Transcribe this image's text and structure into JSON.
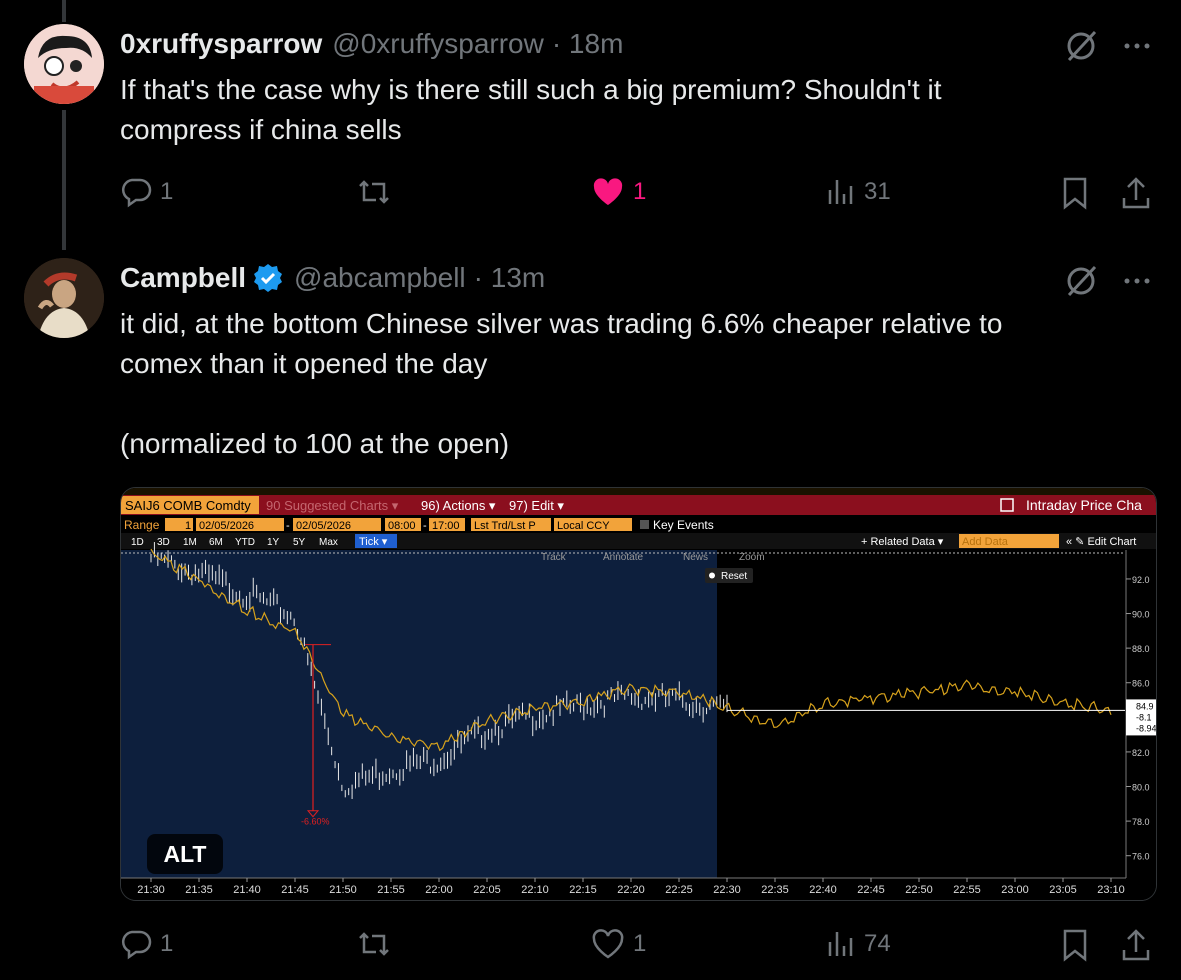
{
  "tweet1": {
    "name": "0xruffysparrow",
    "handle": "@0xruffysparrow",
    "time": "· 18m",
    "text": "If that's the case why is there still such a big premium? Shouldn't it\ncompress if china sells",
    "replies": "1",
    "likes": "1",
    "views": "31"
  },
  "tweet2": {
    "name": "Campbell",
    "handle": "@abcampbell",
    "time": "· 13m",
    "text": "it did, at the bottom Chinese silver was trading 6.6% cheaper relative to\ncomex than it opened the day\n\n(normalized to 100 at the open)",
    "replies": "1",
    "likes": "1",
    "views": "74",
    "alt_label": "ALT"
  },
  "terminal": {
    "ticker": "SAIJ6 COMB Comdty",
    "suggested": "90 Suggested Charts ▾",
    "actions": "96) Actions ▾",
    "edit": "97) Edit ▾",
    "title": "Intraday Price Cha",
    "range_label": "Range",
    "range_num": "1",
    "date_from": "02/05/2026",
    "date_to": "02/05/2026",
    "time_from": "08:00",
    "time_to": "17:00",
    "price_type": "Lst Trd/Lst P",
    "currency": "Local CCY",
    "key_events": "Key Events",
    "periods": [
      "1D",
      "3D",
      "1M",
      "6M",
      "YTD",
      "1Y",
      "5Y",
      "Max"
    ],
    "tick": "Tick ▾",
    "related": "+ Related Data ▾",
    "add_data": "Add Data",
    "edit_chart": "« ✎ Edit Chart",
    "tools": [
      "Track",
      "Annotate",
      "News",
      "Zoom"
    ],
    "reset": "Reset",
    "min_label": "-6.60%",
    "right_labels": [
      "84.9",
      "-8.1",
      "-8.94"
    ]
  },
  "chart_data": {
    "type": "line",
    "x": [
      "21:30",
      "21:35",
      "21:40",
      "21:45",
      "21:50",
      "21:55",
      "22:00",
      "22:05",
      "22:10",
      "22:15",
      "22:20",
      "22:25",
      "22:30",
      "22:35",
      "22:40",
      "22:45",
      "22:50",
      "22:55",
      "23:00",
      "23:05",
      "23:10"
    ],
    "yticks": [
      "92.0",
      "90.0",
      "88.0",
      "86.0",
      "84.0",
      "82.0",
      "80.0",
      "78.0",
      "76.0"
    ],
    "ylim": [
      75,
      93.5
    ],
    "series": [
      {
        "values": [
          93.2,
          92.3,
          91.1,
          89.8,
          80.0,
          81.0,
          81.6,
          83.3,
          84.1,
          84.7,
          85.2,
          85.0,
          84.4
        ]
      },
      {
        "values": [
          93.4,
          92.0,
          90.2,
          89.0,
          84.2,
          82.8,
          82.3,
          83.8,
          84.6,
          84.9,
          85.6,
          85.4,
          84.6,
          83.5,
          84.8,
          85.1,
          85.4,
          85.8,
          85.5,
          84.9,
          84.4
        ]
      }
    ],
    "min_annotation": "-6.60%"
  }
}
